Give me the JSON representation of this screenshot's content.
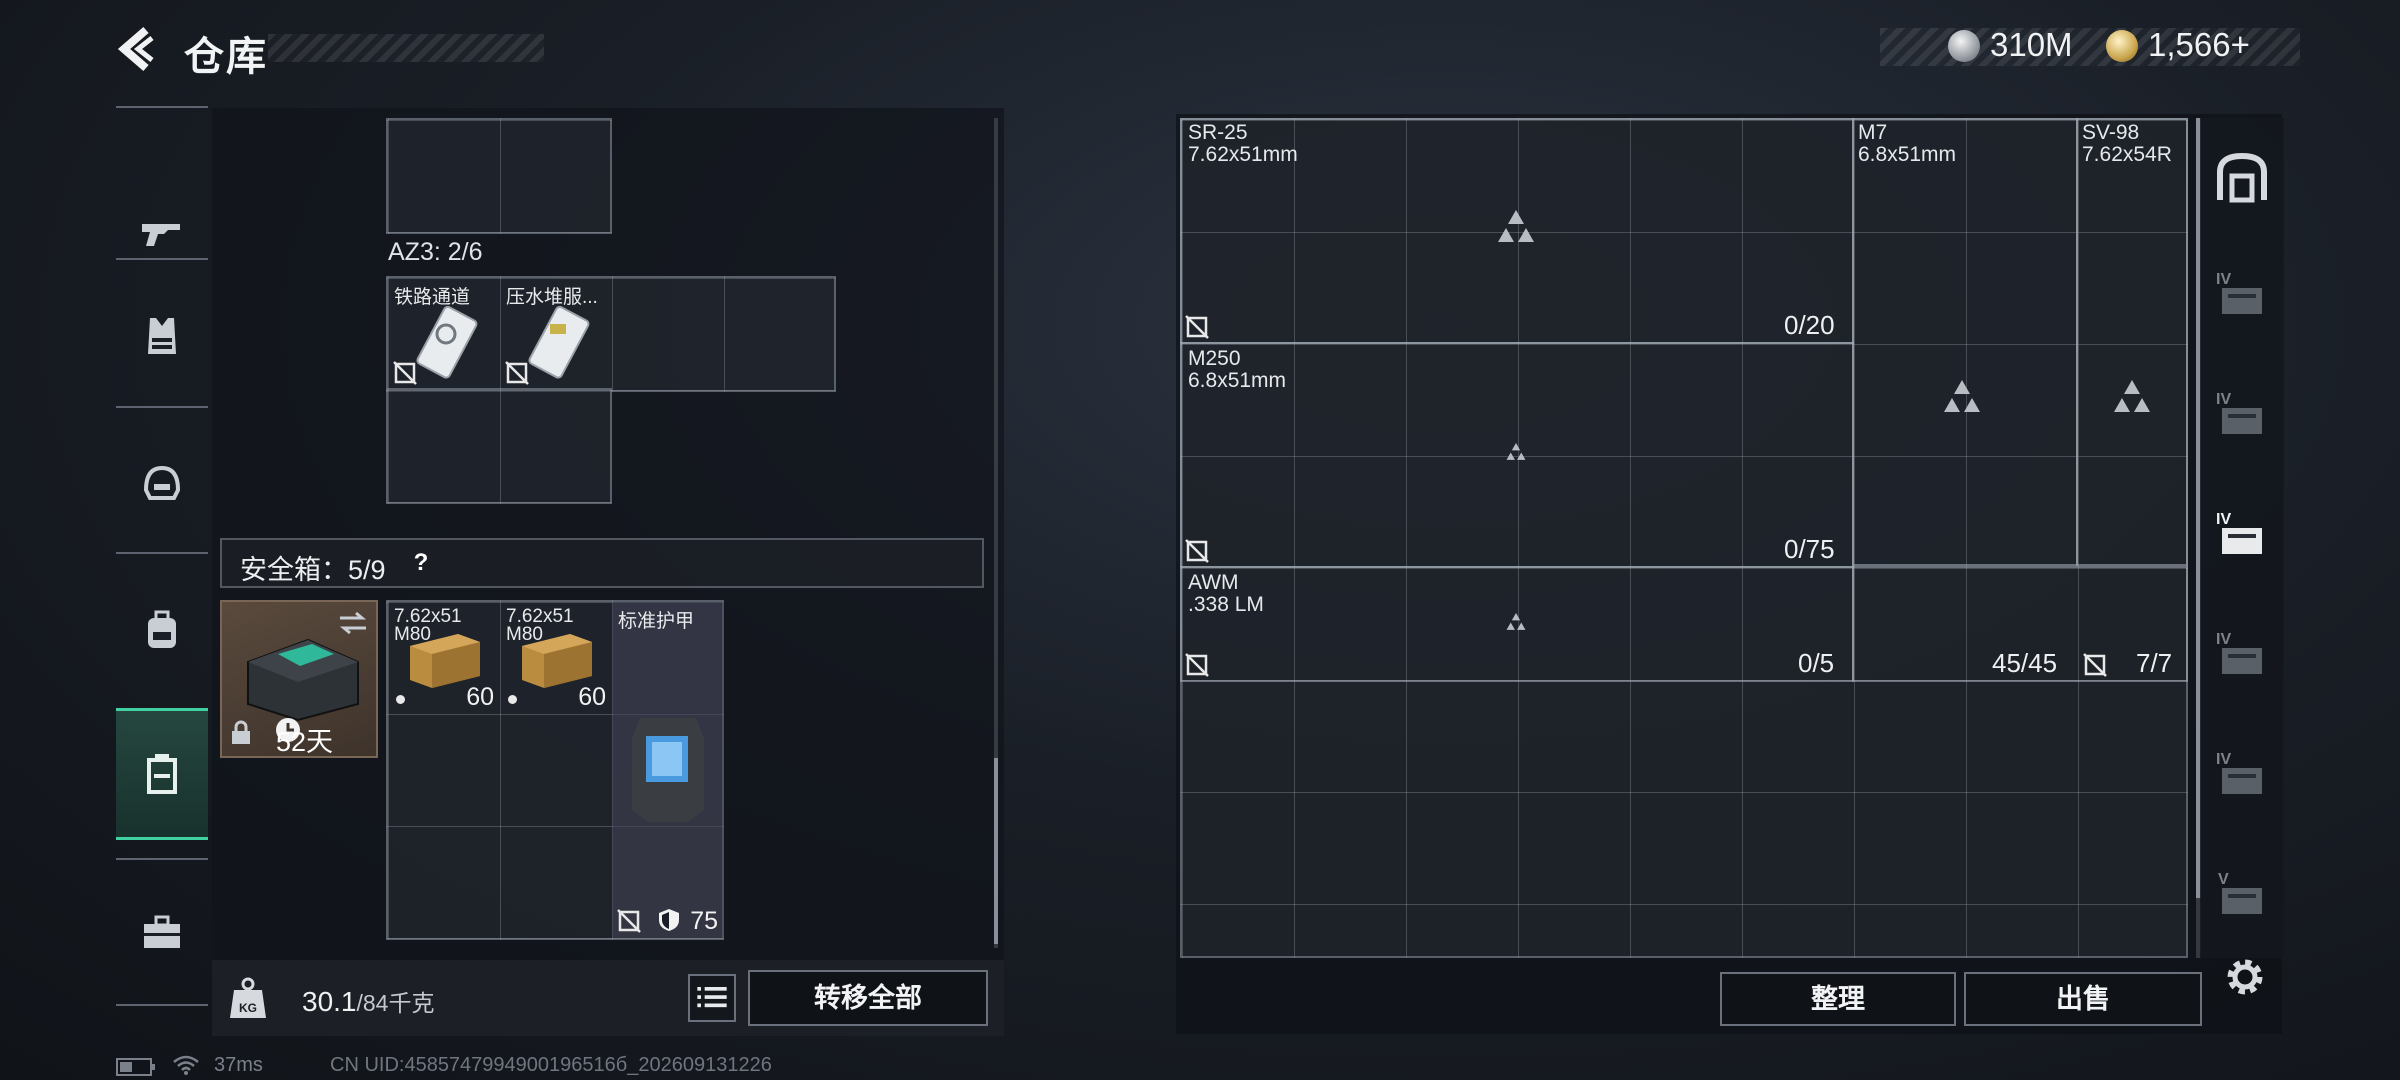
{
  "header": {
    "title": "仓库",
    "back_icon": "back-arrow-icon"
  },
  "currency": {
    "silver": "310M",
    "gold": "1,566+"
  },
  "nav": {
    "items": [
      {
        "name": "gun-icon"
      },
      {
        "name": "vest-icon"
      },
      {
        "name": "helmet-icon"
      },
      {
        "name": "backpack-icon"
      },
      {
        "name": "safebox-icon",
        "active": true
      },
      {
        "name": "toolbox-icon"
      }
    ]
  },
  "left": {
    "az3_label": "AZ3: 2/6",
    "az3_items": [
      {
        "name": "铁路通道"
      },
      {
        "name": "压水堆服..."
      }
    ],
    "safebox_label": "安全箱：5/9",
    "safebox_help": "?",
    "safebox_days": "52天",
    "safebox_items": [
      {
        "name": "7.62x51",
        "sub": "M80",
        "qty": "60"
      },
      {
        "name": "7.62x51",
        "sub": "M80",
        "qty": "60"
      },
      {
        "name": "标准护甲",
        "durability": "75"
      }
    ],
    "weight": "30.1",
    "weight_unit": "/84千克",
    "transfer_all": "转移全部"
  },
  "stash": {
    "slots": [
      {
        "name": "SR-25",
        "caliber": "7.62x51mm",
        "count": "0/20"
      },
      {
        "name": "M7",
        "caliber": "6.8x51mm"
      },
      {
        "name": "SV-98",
        "caliber": "7.62x54R"
      },
      {
        "name": "M250",
        "caliber": "6.8x51mm",
        "count": "0/75"
      },
      {
        "name": "AWM",
        "caliber": ".338 LM",
        "count": "0/5"
      },
      {
        "count": "45/45"
      },
      {
        "count": "7/7"
      }
    ],
    "sort": "整理",
    "sell": "出售"
  },
  "side_tabs": {
    "tier_label": "IV"
  },
  "status": {
    "ping": "37ms",
    "uid": "CN UID:4585747994900196516б_202609131226"
  }
}
